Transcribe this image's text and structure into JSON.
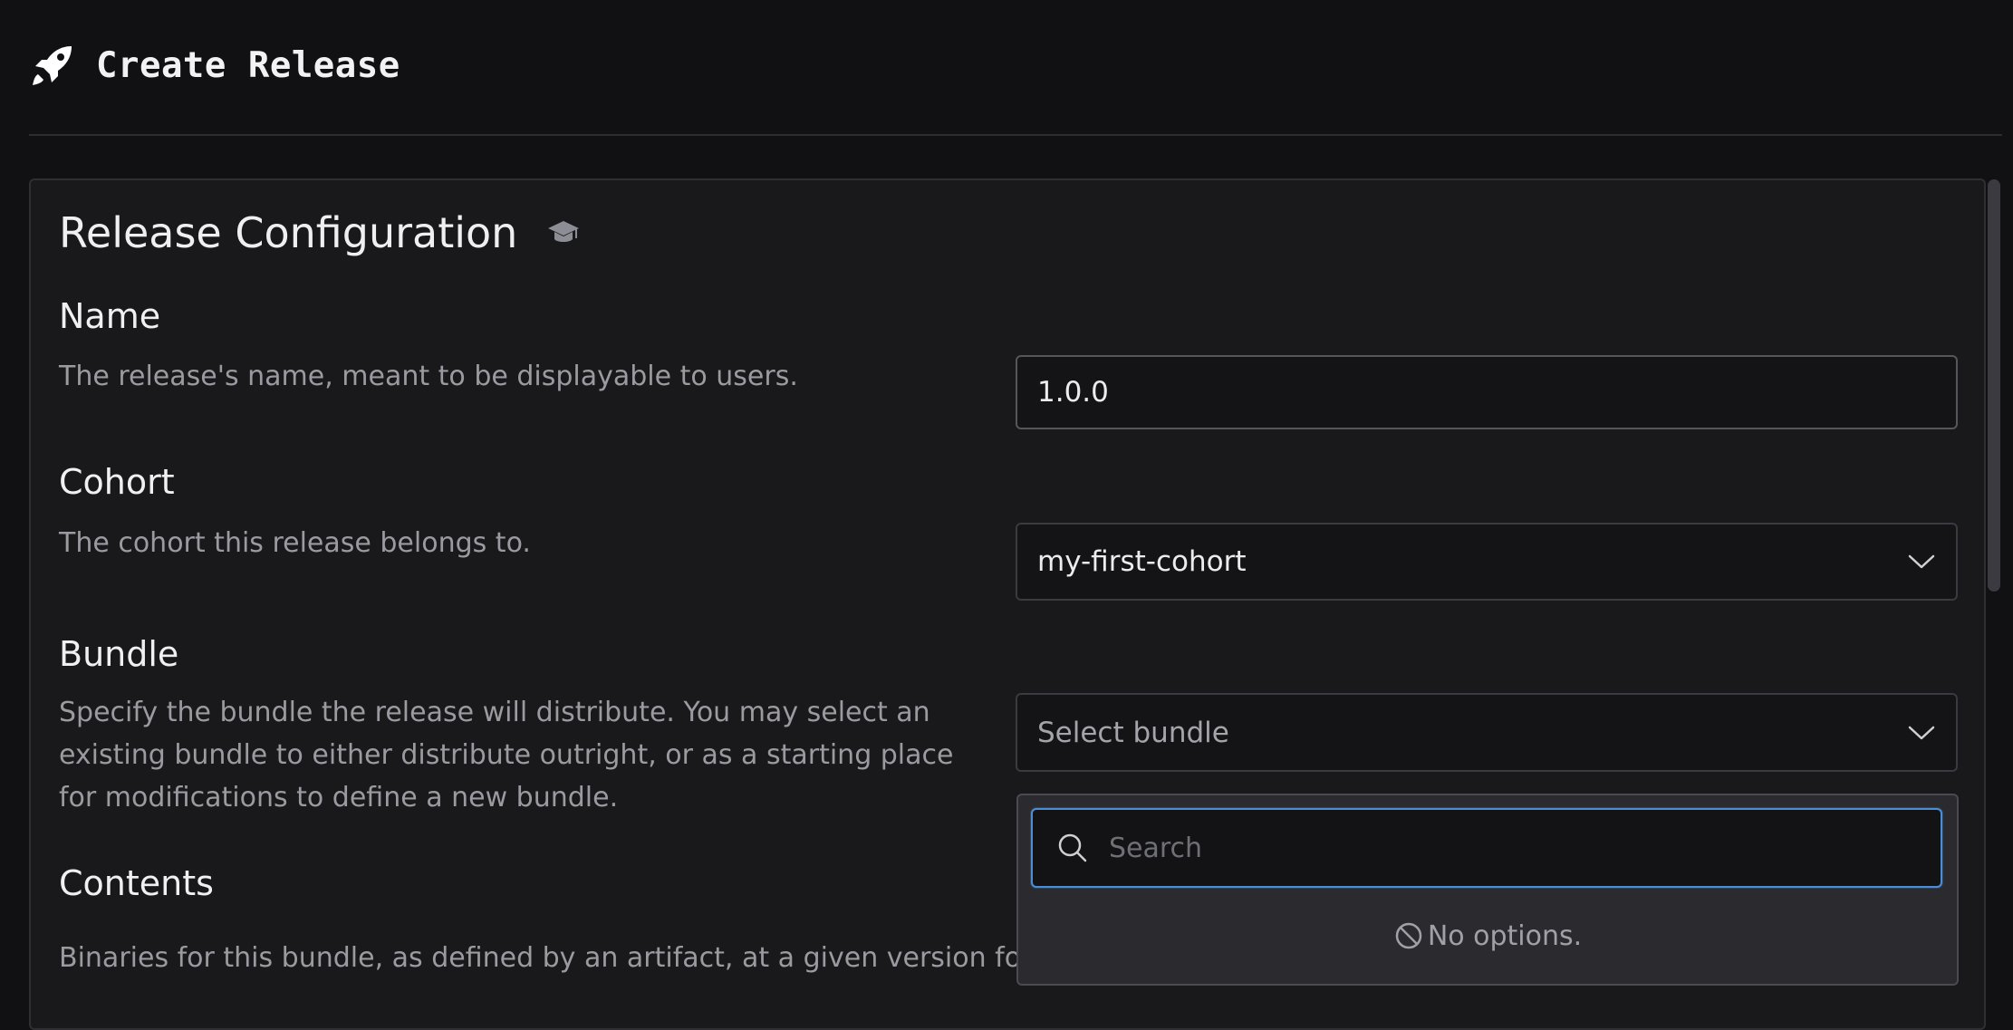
{
  "header": {
    "title": "Create Release",
    "icon": "rocket-icon"
  },
  "section": {
    "title": "Release Configuration",
    "icon": "graduation-cap-icon"
  },
  "fields": {
    "name": {
      "label": "Name",
      "description": "The release's name, meant to be displayable to users.",
      "value": "1.0.0"
    },
    "cohort": {
      "label": "Cohort",
      "description": "The cohort this release belongs to.",
      "value": "my-first-cohort"
    },
    "bundle": {
      "label": "Bundle",
      "description": "Specify the bundle the release will distribute. You may select an existing bundle to either distribute outright, or as a starting place for modifications to define a new bundle.",
      "placeholder": "Select bundle"
    },
    "contents": {
      "label": "Contents",
      "description": "Binaries for this bundle, as defined by an artifact, at a given version fo"
    }
  },
  "dropdown": {
    "search_placeholder": "Search",
    "empty_text": "No options."
  },
  "colors": {
    "accent": "#4a8fd6",
    "background": "#111114",
    "panel": "#19191c"
  }
}
